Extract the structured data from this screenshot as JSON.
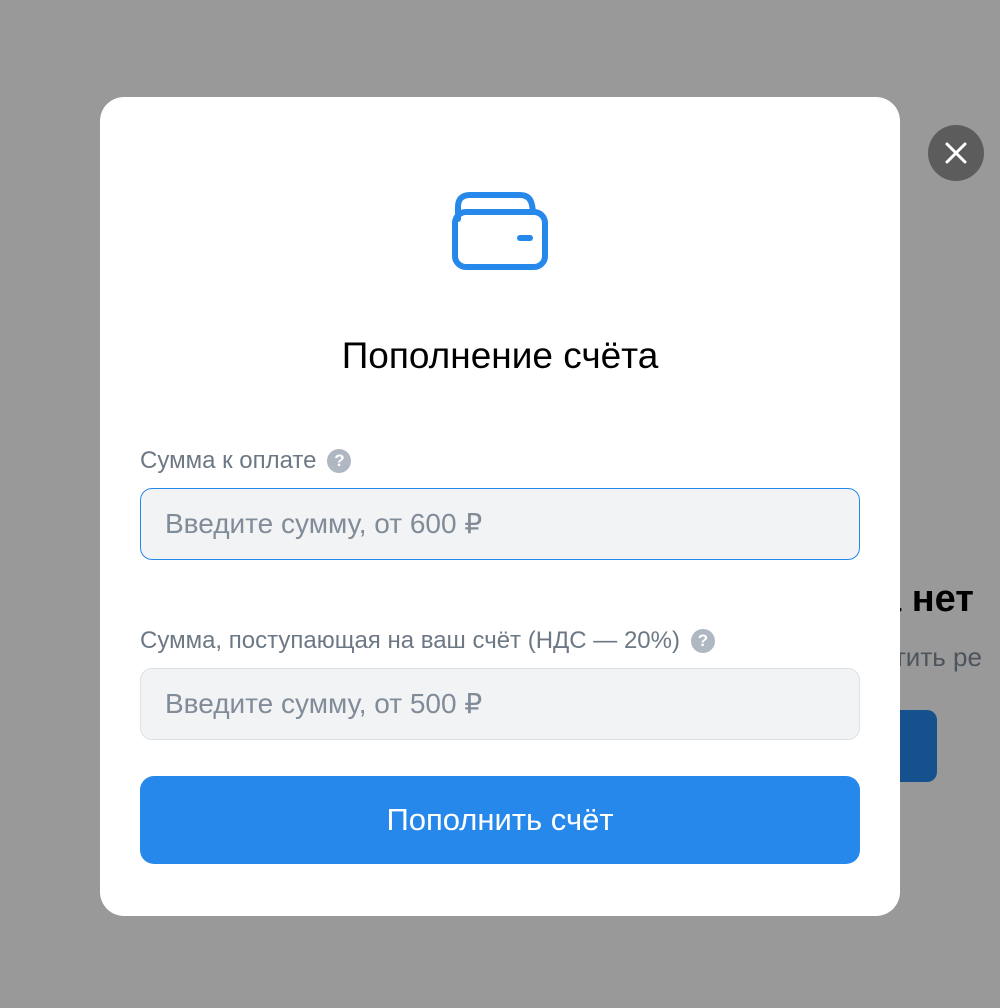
{
  "background": {
    "heading": "а нет",
    "subtext": "атить ре"
  },
  "close_button": {
    "icon": "close-icon"
  },
  "modal": {
    "icon": "wallet-icon",
    "title": "Пополнение счёта",
    "amount_field": {
      "label": "Сумма к оплате",
      "placeholder": "Введите сумму, от 600 ₽",
      "value": "",
      "help_icon": "?"
    },
    "received_field": {
      "label": "Сумма, поступающая на ваш счёт (НДС — 20%)",
      "placeholder": "Введите сумму, от 500 ₽",
      "value": "",
      "help_icon": "?"
    },
    "submit_label": "Пополнить счёт"
  },
  "colors": {
    "accent": "#2688eb",
    "overlay": "rgba(0,0,0,0.40)",
    "label": "#6d7885",
    "input_bg": "#f2f3f5"
  }
}
